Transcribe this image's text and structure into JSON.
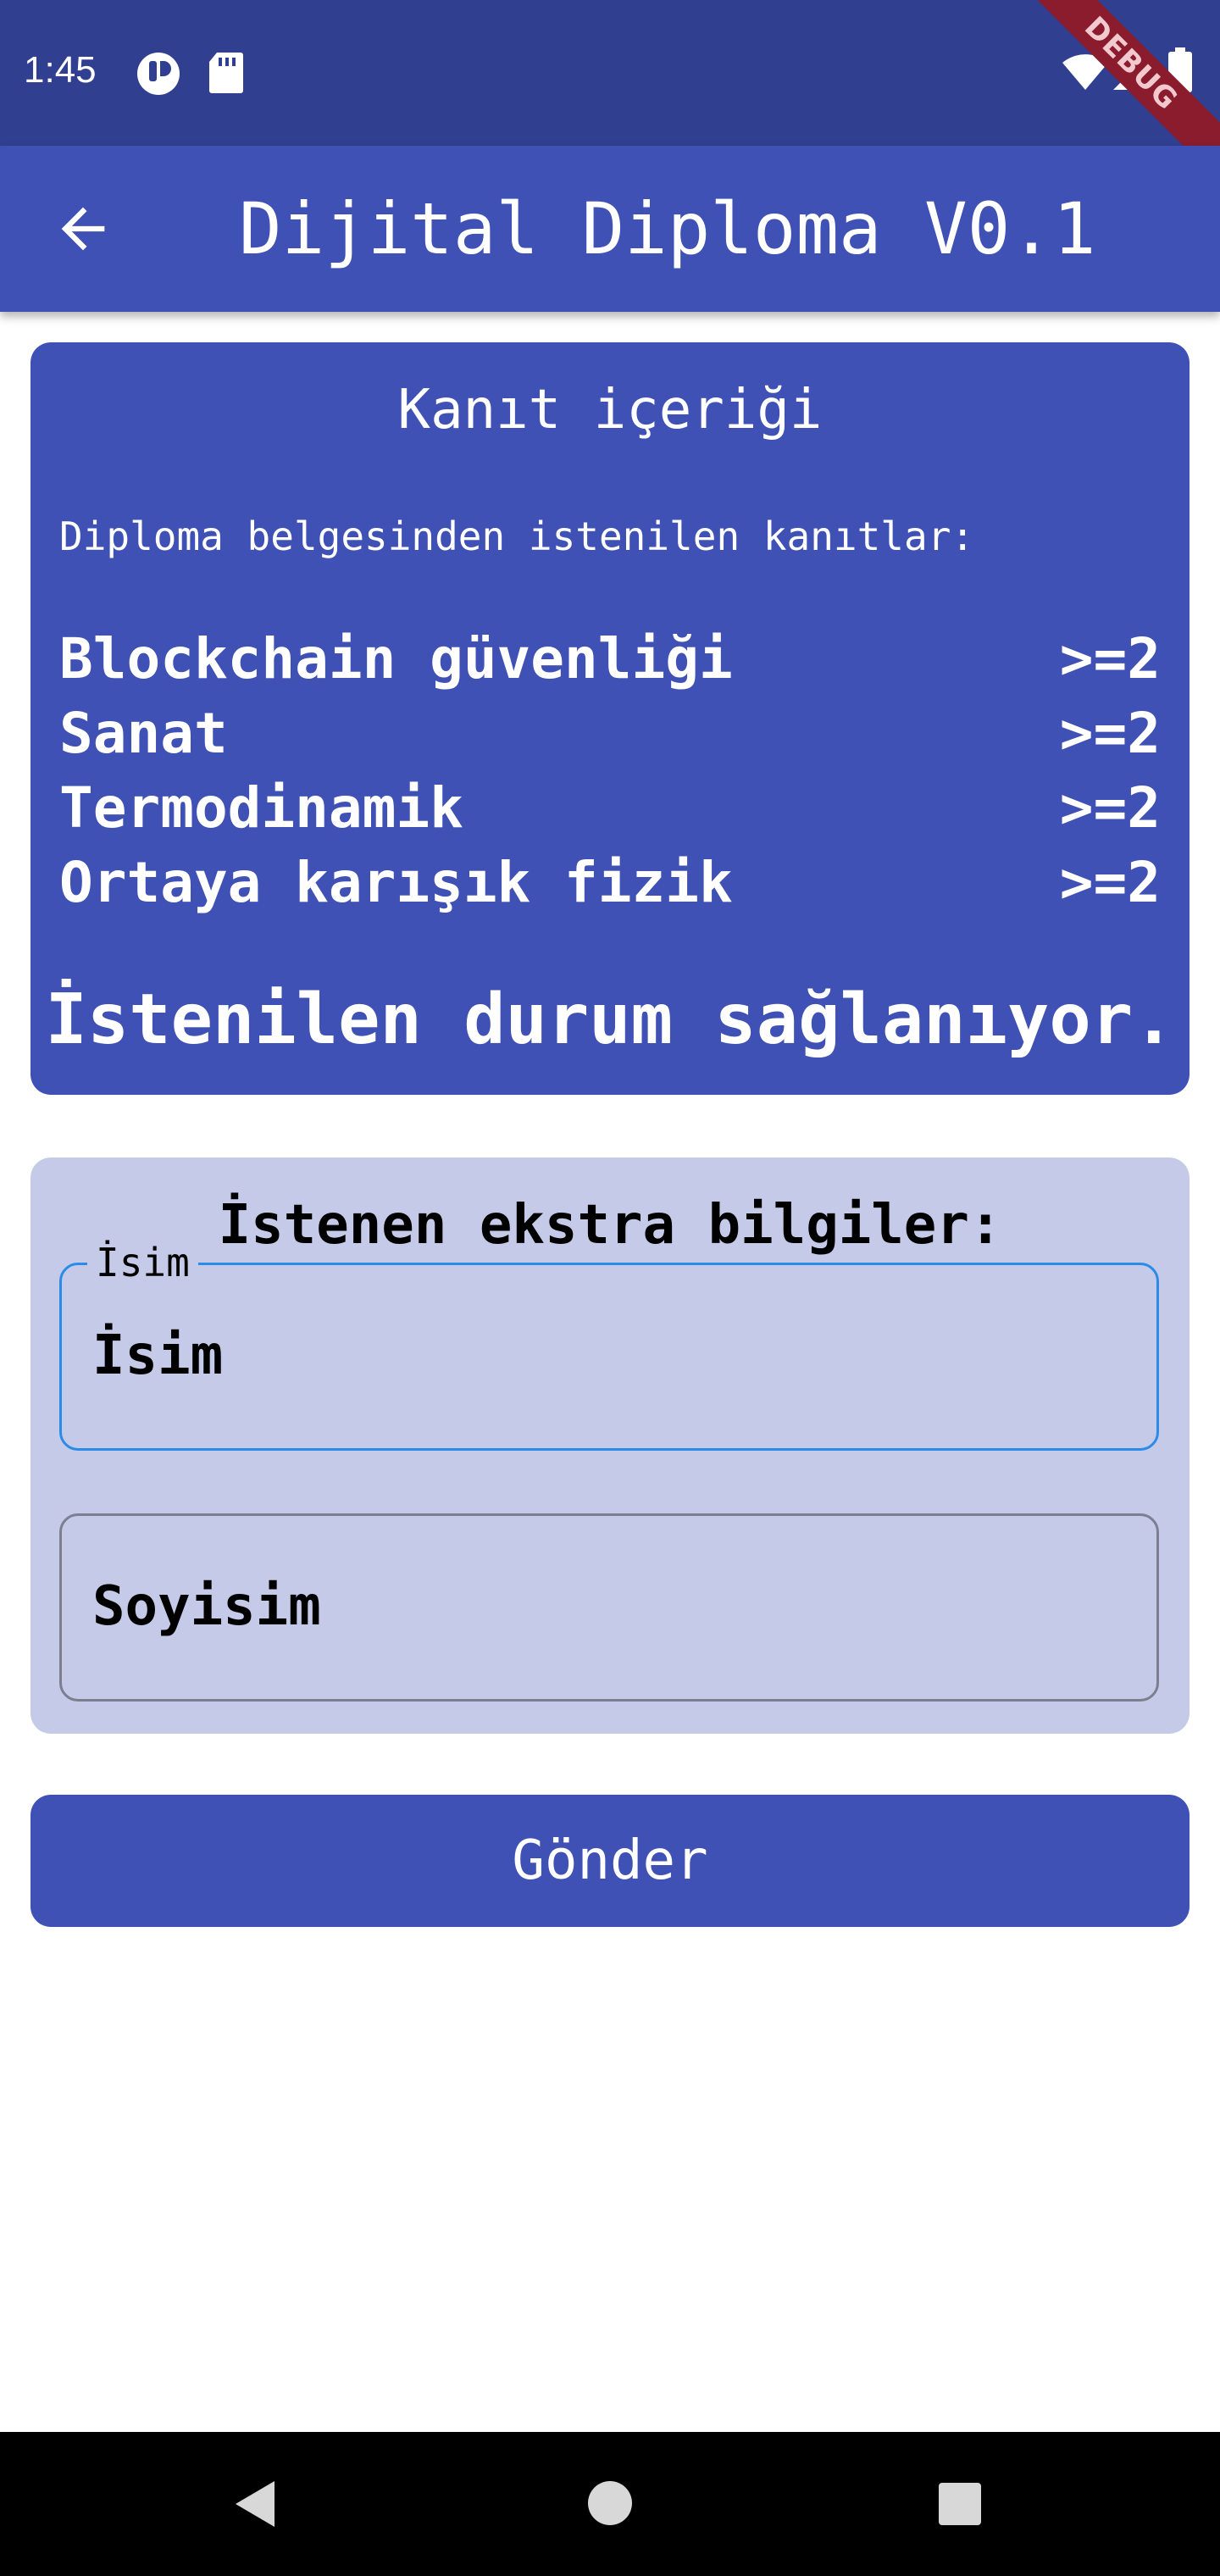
{
  "status_bar": {
    "time": "1:45",
    "debug_banner": "DEBUG",
    "icons": [
      "notification-icon",
      "sd-card-icon",
      "wifi-icon",
      "signal-icon",
      "battery-icon"
    ]
  },
  "app_bar": {
    "title": "Dijital Diploma V0.1",
    "back_icon": "arrow-left-icon"
  },
  "proof": {
    "title": "Kanıt içeriği",
    "subtitle": "Diploma belgesinden istenilen kanıtlar:",
    "items": [
      {
        "name": "Blockchain güvenliği",
        "value": ">=2"
      },
      {
        "name": "Sanat",
        "value": ">=2"
      },
      {
        "name": "Termodinamik",
        "value": ">=2"
      },
      {
        "name": "Ortaya karışık fizik",
        "value": ">=2"
      }
    ],
    "result": "İstenilen durum sağlanıyor."
  },
  "extra_info": {
    "title": "İstenen ekstra bilgiler:",
    "name_field": {
      "label": "İsim",
      "value": "İsim"
    },
    "surname_field": {
      "placeholder": "Soyisim"
    }
  },
  "submit": {
    "label": "Gönder"
  },
  "colors": {
    "status_bar": "#303f8f",
    "primary": "#3f51b5",
    "card_light": "#c5cae9",
    "focus_border": "#2b8be8",
    "debug_banner": "#8b1c2e"
  }
}
